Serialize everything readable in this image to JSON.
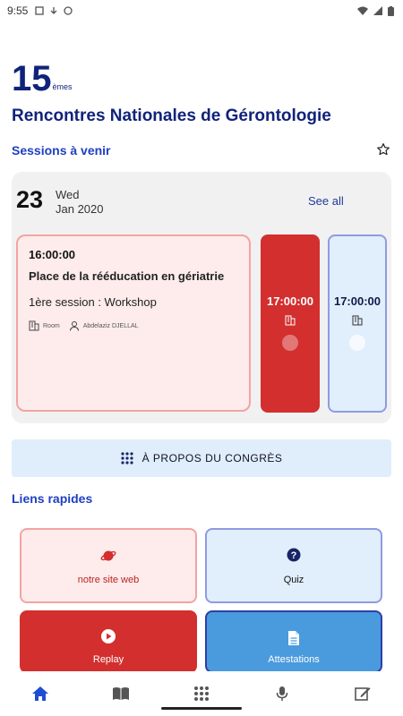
{
  "status": {
    "time": "9:55"
  },
  "hero": {
    "number": "15",
    "suffix": "èmes",
    "title": "Rencontres Nationales de Gérontologie"
  },
  "sessions_header": "Sessions à venir",
  "date": {
    "day": "23",
    "weekday": "Wed",
    "month_year": "Jan 2020",
    "see_all": "See all"
  },
  "session_main": {
    "time": "16:00:00",
    "title": "Place de la rééducation en gériatrie",
    "subtitle": "1ère session : Workshop",
    "room_label": "Room",
    "speaker": "Abdelaziz DJELLAL"
  },
  "session_red": {
    "time": "17:00:00"
  },
  "session_blue": {
    "time": "17:00:00"
  },
  "about_button": "À PROPOS DU CONGRÈS",
  "quick_links_header": "Liens rapides",
  "tiles": [
    {
      "label": "notre site web",
      "icon": "planet-icon"
    },
    {
      "label": "Quiz",
      "icon": "question-icon"
    },
    {
      "label": "Replay",
      "icon": "play-icon"
    },
    {
      "label": "Attestations",
      "icon": "document-icon"
    }
  ],
  "bottom_nav": [
    "home-icon",
    "book-icon",
    "grid-icon",
    "mic-icon",
    "edit-icon"
  ],
  "colors": {
    "brand_navy": "#10237a",
    "link_blue": "#1f3fc2",
    "red": "#d32f2f",
    "pink_bg": "#fdeceb",
    "light_blue_bg": "#e1eefc",
    "attestations_blue": "#4a9ade"
  }
}
